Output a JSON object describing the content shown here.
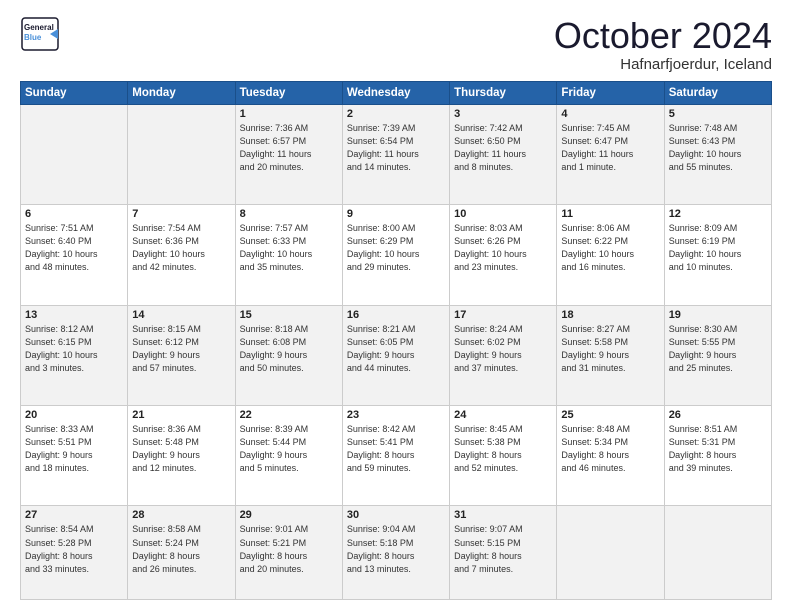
{
  "header": {
    "logo_line1": "General",
    "logo_line2": "Blue",
    "month_title": "October 2024",
    "location": "Hafnarfjoerdur, Iceland"
  },
  "days_of_week": [
    "Sunday",
    "Monday",
    "Tuesday",
    "Wednesday",
    "Thursday",
    "Friday",
    "Saturday"
  ],
  "weeks": [
    [
      {
        "num": "",
        "detail": ""
      },
      {
        "num": "",
        "detail": ""
      },
      {
        "num": "1",
        "detail": "Sunrise: 7:36 AM\nSunset: 6:57 PM\nDaylight: 11 hours\nand 20 minutes."
      },
      {
        "num": "2",
        "detail": "Sunrise: 7:39 AM\nSunset: 6:54 PM\nDaylight: 11 hours\nand 14 minutes."
      },
      {
        "num": "3",
        "detail": "Sunrise: 7:42 AM\nSunset: 6:50 PM\nDaylight: 11 hours\nand 8 minutes."
      },
      {
        "num": "4",
        "detail": "Sunrise: 7:45 AM\nSunset: 6:47 PM\nDaylight: 11 hours\nand 1 minute."
      },
      {
        "num": "5",
        "detail": "Sunrise: 7:48 AM\nSunset: 6:43 PM\nDaylight: 10 hours\nand 55 minutes."
      }
    ],
    [
      {
        "num": "6",
        "detail": "Sunrise: 7:51 AM\nSunset: 6:40 PM\nDaylight: 10 hours\nand 48 minutes."
      },
      {
        "num": "7",
        "detail": "Sunrise: 7:54 AM\nSunset: 6:36 PM\nDaylight: 10 hours\nand 42 minutes."
      },
      {
        "num": "8",
        "detail": "Sunrise: 7:57 AM\nSunset: 6:33 PM\nDaylight: 10 hours\nand 35 minutes."
      },
      {
        "num": "9",
        "detail": "Sunrise: 8:00 AM\nSunset: 6:29 PM\nDaylight: 10 hours\nand 29 minutes."
      },
      {
        "num": "10",
        "detail": "Sunrise: 8:03 AM\nSunset: 6:26 PM\nDaylight: 10 hours\nand 23 minutes."
      },
      {
        "num": "11",
        "detail": "Sunrise: 8:06 AM\nSunset: 6:22 PM\nDaylight: 10 hours\nand 16 minutes."
      },
      {
        "num": "12",
        "detail": "Sunrise: 8:09 AM\nSunset: 6:19 PM\nDaylight: 10 hours\nand 10 minutes."
      }
    ],
    [
      {
        "num": "13",
        "detail": "Sunrise: 8:12 AM\nSunset: 6:15 PM\nDaylight: 10 hours\nand 3 minutes."
      },
      {
        "num": "14",
        "detail": "Sunrise: 8:15 AM\nSunset: 6:12 PM\nDaylight: 9 hours\nand 57 minutes."
      },
      {
        "num": "15",
        "detail": "Sunrise: 8:18 AM\nSunset: 6:08 PM\nDaylight: 9 hours\nand 50 minutes."
      },
      {
        "num": "16",
        "detail": "Sunrise: 8:21 AM\nSunset: 6:05 PM\nDaylight: 9 hours\nand 44 minutes."
      },
      {
        "num": "17",
        "detail": "Sunrise: 8:24 AM\nSunset: 6:02 PM\nDaylight: 9 hours\nand 37 minutes."
      },
      {
        "num": "18",
        "detail": "Sunrise: 8:27 AM\nSunset: 5:58 PM\nDaylight: 9 hours\nand 31 minutes."
      },
      {
        "num": "19",
        "detail": "Sunrise: 8:30 AM\nSunset: 5:55 PM\nDaylight: 9 hours\nand 25 minutes."
      }
    ],
    [
      {
        "num": "20",
        "detail": "Sunrise: 8:33 AM\nSunset: 5:51 PM\nDaylight: 9 hours\nand 18 minutes."
      },
      {
        "num": "21",
        "detail": "Sunrise: 8:36 AM\nSunset: 5:48 PM\nDaylight: 9 hours\nand 12 minutes."
      },
      {
        "num": "22",
        "detail": "Sunrise: 8:39 AM\nSunset: 5:44 PM\nDaylight: 9 hours\nand 5 minutes."
      },
      {
        "num": "23",
        "detail": "Sunrise: 8:42 AM\nSunset: 5:41 PM\nDaylight: 8 hours\nand 59 minutes."
      },
      {
        "num": "24",
        "detail": "Sunrise: 8:45 AM\nSunset: 5:38 PM\nDaylight: 8 hours\nand 52 minutes."
      },
      {
        "num": "25",
        "detail": "Sunrise: 8:48 AM\nSunset: 5:34 PM\nDaylight: 8 hours\nand 46 minutes."
      },
      {
        "num": "26",
        "detail": "Sunrise: 8:51 AM\nSunset: 5:31 PM\nDaylight: 8 hours\nand 39 minutes."
      }
    ],
    [
      {
        "num": "27",
        "detail": "Sunrise: 8:54 AM\nSunset: 5:28 PM\nDaylight: 8 hours\nand 33 minutes."
      },
      {
        "num": "28",
        "detail": "Sunrise: 8:58 AM\nSunset: 5:24 PM\nDaylight: 8 hours\nand 26 minutes."
      },
      {
        "num": "29",
        "detail": "Sunrise: 9:01 AM\nSunset: 5:21 PM\nDaylight: 8 hours\nand 20 minutes."
      },
      {
        "num": "30",
        "detail": "Sunrise: 9:04 AM\nSunset: 5:18 PM\nDaylight: 8 hours\nand 13 minutes."
      },
      {
        "num": "31",
        "detail": "Sunrise: 9:07 AM\nSunset: 5:15 PM\nDaylight: 8 hours\nand 7 minutes."
      },
      {
        "num": "",
        "detail": ""
      },
      {
        "num": "",
        "detail": ""
      }
    ]
  ]
}
